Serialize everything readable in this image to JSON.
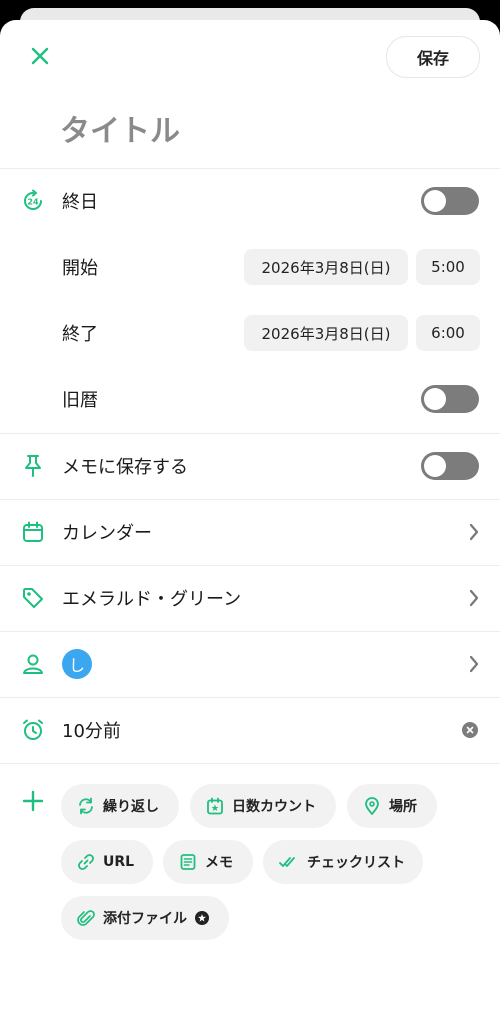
{
  "header": {
    "close_icon": "close-x-icon",
    "save_label": "保存",
    "title_placeholder": "タイトル"
  },
  "rows": {
    "all_day": {
      "label": "終日",
      "icon": "24-hour-icon",
      "toggle_on": false
    },
    "start": {
      "label": "開始",
      "date": "2026年3月8日(日)",
      "time": "5:00"
    },
    "end": {
      "label": "終了",
      "date": "2026年3月8日(日)",
      "time": "6:00"
    },
    "lunar": {
      "label": "旧暦",
      "toggle_on": false
    },
    "save_memo": {
      "label": "メモに保存する",
      "icon": "pin-icon",
      "toggle_on": false
    },
    "calendar": {
      "label": "カレンダー",
      "icon": "calendar-icon"
    },
    "color": {
      "label": "エメラルド・グリーン",
      "icon": "tag-icon"
    },
    "member": {
      "icon": "person-icon",
      "avatar_letter": "し"
    },
    "reminder": {
      "label": "10分前",
      "icon": "alarm-clock-icon"
    }
  },
  "actions": [
    {
      "label": "繰り返し",
      "icon": "repeat-icon"
    },
    {
      "label": "日数カウント",
      "icon": "calendar-star-icon"
    },
    {
      "label": "場所",
      "icon": "location-pin-icon"
    },
    {
      "label": "URL",
      "icon": "link-icon"
    },
    {
      "label": "メモ",
      "icon": "note-icon"
    },
    {
      "label": "チェックリスト",
      "icon": "double-check-icon"
    },
    {
      "label": "添付ファイル",
      "icon": "paperclip-icon",
      "premium": true
    }
  ],
  "colors": {
    "accent": "#1fbf7f",
    "toggle_off": "#7c7c7c",
    "avatar": "#3ba7f0"
  }
}
